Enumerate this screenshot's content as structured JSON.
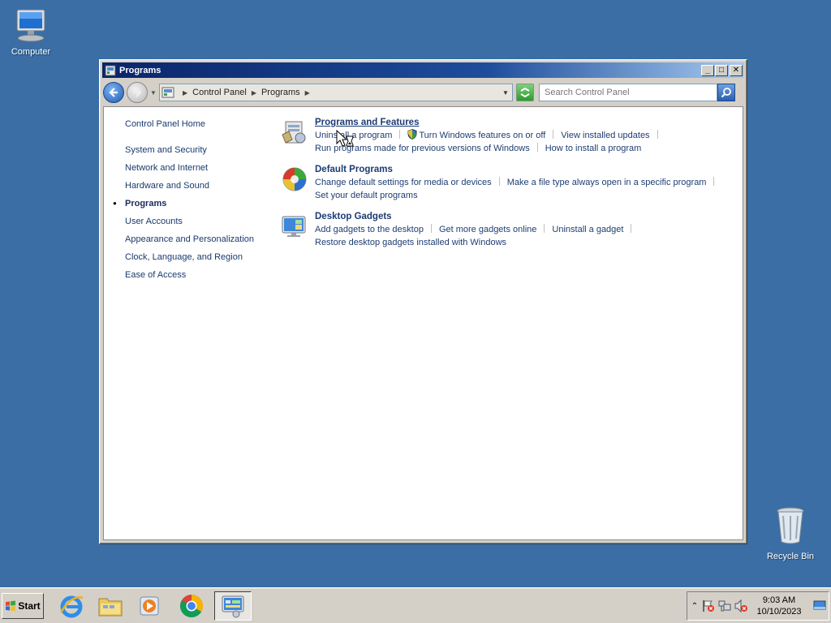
{
  "desktop": {
    "computer_label": "Computer",
    "recycle_label": "Recycle Bin"
  },
  "window": {
    "title": "Programs",
    "buttons": {
      "minimize": "_",
      "maximize": "□",
      "close": "✕"
    }
  },
  "address": {
    "crumbs": [
      "Control Panel",
      "Programs"
    ],
    "search_placeholder": "Search Control Panel"
  },
  "sidebar": {
    "home": "Control Panel Home",
    "items": [
      "System and Security",
      "Network and Internet",
      "Hardware and Sound",
      "Programs",
      "User Accounts",
      "Appearance and Personalization",
      "Clock, Language, and Region",
      "Ease of Access"
    ],
    "current_index": 3
  },
  "categories": [
    {
      "title": "Programs and Features",
      "icon": "programs-features-icon",
      "lines": [
        [
          "Uninstall a program",
          "Turn Windows features on or off",
          "View installed updates"
        ],
        [
          "Run programs made for previous versions of Windows",
          "How to install a program"
        ]
      ]
    },
    {
      "title": "Default Programs",
      "icon": "default-programs-icon",
      "lines": [
        [
          "Change default settings for media or devices",
          "Make a file type always open in a specific program"
        ],
        [
          "Set your default programs"
        ]
      ]
    },
    {
      "title": "Desktop Gadgets",
      "icon": "desktop-gadgets-icon",
      "lines": [
        [
          "Add gadgets to the desktop",
          "Get more gadgets online",
          "Uninstall a gadget"
        ],
        [
          "Restore desktop gadgets installed with Windows"
        ]
      ]
    }
  ],
  "taskbar": {
    "start_label": "Start",
    "apps": [
      "internet-explorer-icon",
      "file-explorer-icon",
      "media-player-icon",
      "chrome-icon",
      "control-panel-icon"
    ],
    "time": "9:03 AM",
    "date": "10/10/2023"
  },
  "colors": {
    "desktop": "#3a6ea5",
    "link": "#1e3d73",
    "title_gradient_start": "#0a246a"
  }
}
